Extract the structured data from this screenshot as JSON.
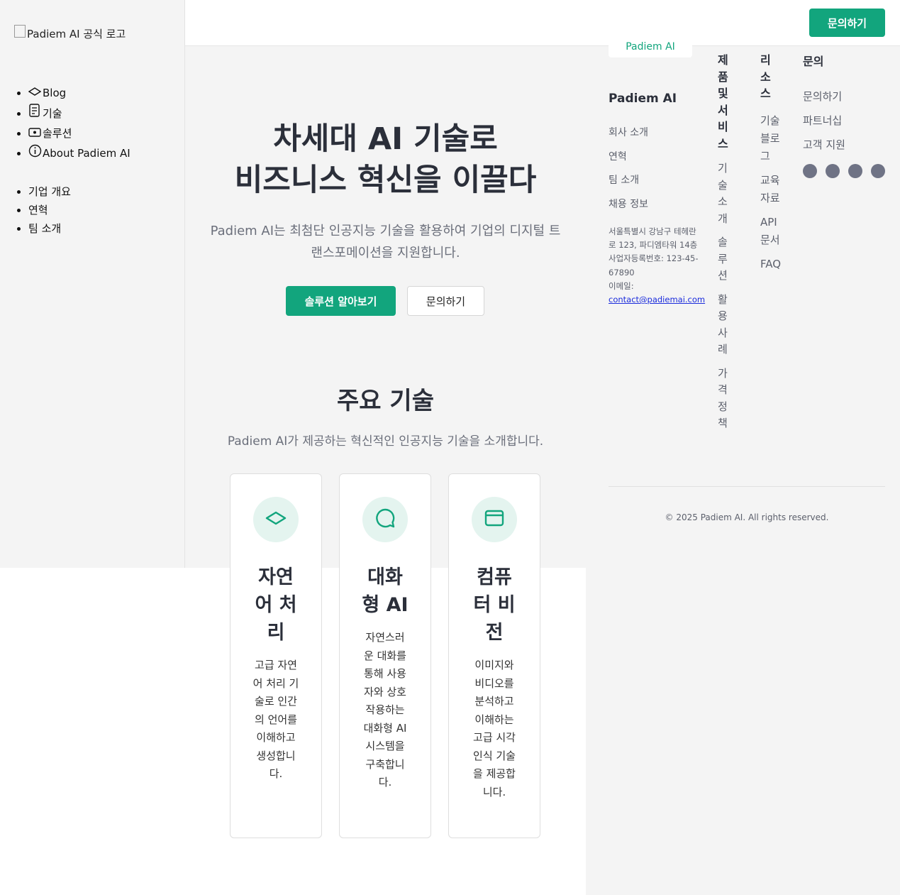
{
  "sidebar": {
    "logo_alt": "Padiem AI 공식 로고",
    "nav_items": [
      {
        "icon": "graduation-icon",
        "label": "Blog"
      },
      {
        "icon": "document-icon",
        "label": "기술"
      },
      {
        "icon": "monitor-icon",
        "label": "솔루션"
      },
      {
        "icon": "info-icon",
        "label": "About Padiem AI"
      }
    ],
    "sub_items": [
      "기업 개요",
      "연혁",
      "팀 소개"
    ]
  },
  "header": {
    "contact_label": "문의하기"
  },
  "hero": {
    "title_line1": "차세대 AI 기술로",
    "title_line2": "비즈니스 혁신을 이끌다",
    "subtitle": "Padiem AI는 최첨단 인공지능 기술을 활용하여 기업의 디지털 트랜스포메이션을 지원합니다.",
    "primary_button": "솔루션 알아보기",
    "secondary_button": "문의하기"
  },
  "technologies": {
    "title": "주요 기술",
    "subtitle": "Padiem AI가 제공하는 혁신적인 인공지능 기술을 소개합니다.",
    "cards": [
      {
        "icon": "layers-icon",
        "title": "자연어 처리",
        "description": "고급 자연어 처리 기술로 인간의 언어를 이해하고 생성합니다."
      },
      {
        "icon": "chat-bubble-icon",
        "title": "대화형 AI",
        "description": "자연스러운 대화를 통해 사용자와 상호작용하는 대화형 AI 시스템을 구축합니다."
      },
      {
        "icon": "window-icon",
        "title": "컴퓨터 비전",
        "description": "이미지와 비디오를 분석하고 이해하는 고급 시각 인식 기술을 제공합니다."
      }
    ]
  },
  "footer": {
    "logo_text": "Padiem AI",
    "company": {
      "heading": "Padiem AI",
      "links": [
        "회사 소개",
        "연혁",
        "팀 소개",
        "채용 정보"
      ],
      "address": "서울특별시 강남구 테헤란로 123, 파디엠타워 14층",
      "business_number": "사업자등록번호: 123-45-67890",
      "email_label": "이메일:",
      "email": "contact@padiemai.com"
    },
    "products": {
      "heading": "제품 및 서비스",
      "links": [
        "기술 소개",
        "솔루션",
        "활용 사례",
        "가격 정책"
      ]
    },
    "resources": {
      "heading": "리소스",
      "links": [
        "기술 블로그",
        "교육 자료",
        "API 문서",
        "FAQ"
      ]
    },
    "contact": {
      "heading": "문의",
      "links": [
        "문의하기",
        "파트너십",
        "고객 지원"
      ]
    },
    "social_icons": [
      "social-icon-1",
      "social-icon-2",
      "social-icon-3",
      "social-icon-4"
    ],
    "copyright": "© 2025 Padiem AI. All rights reserved."
  }
}
